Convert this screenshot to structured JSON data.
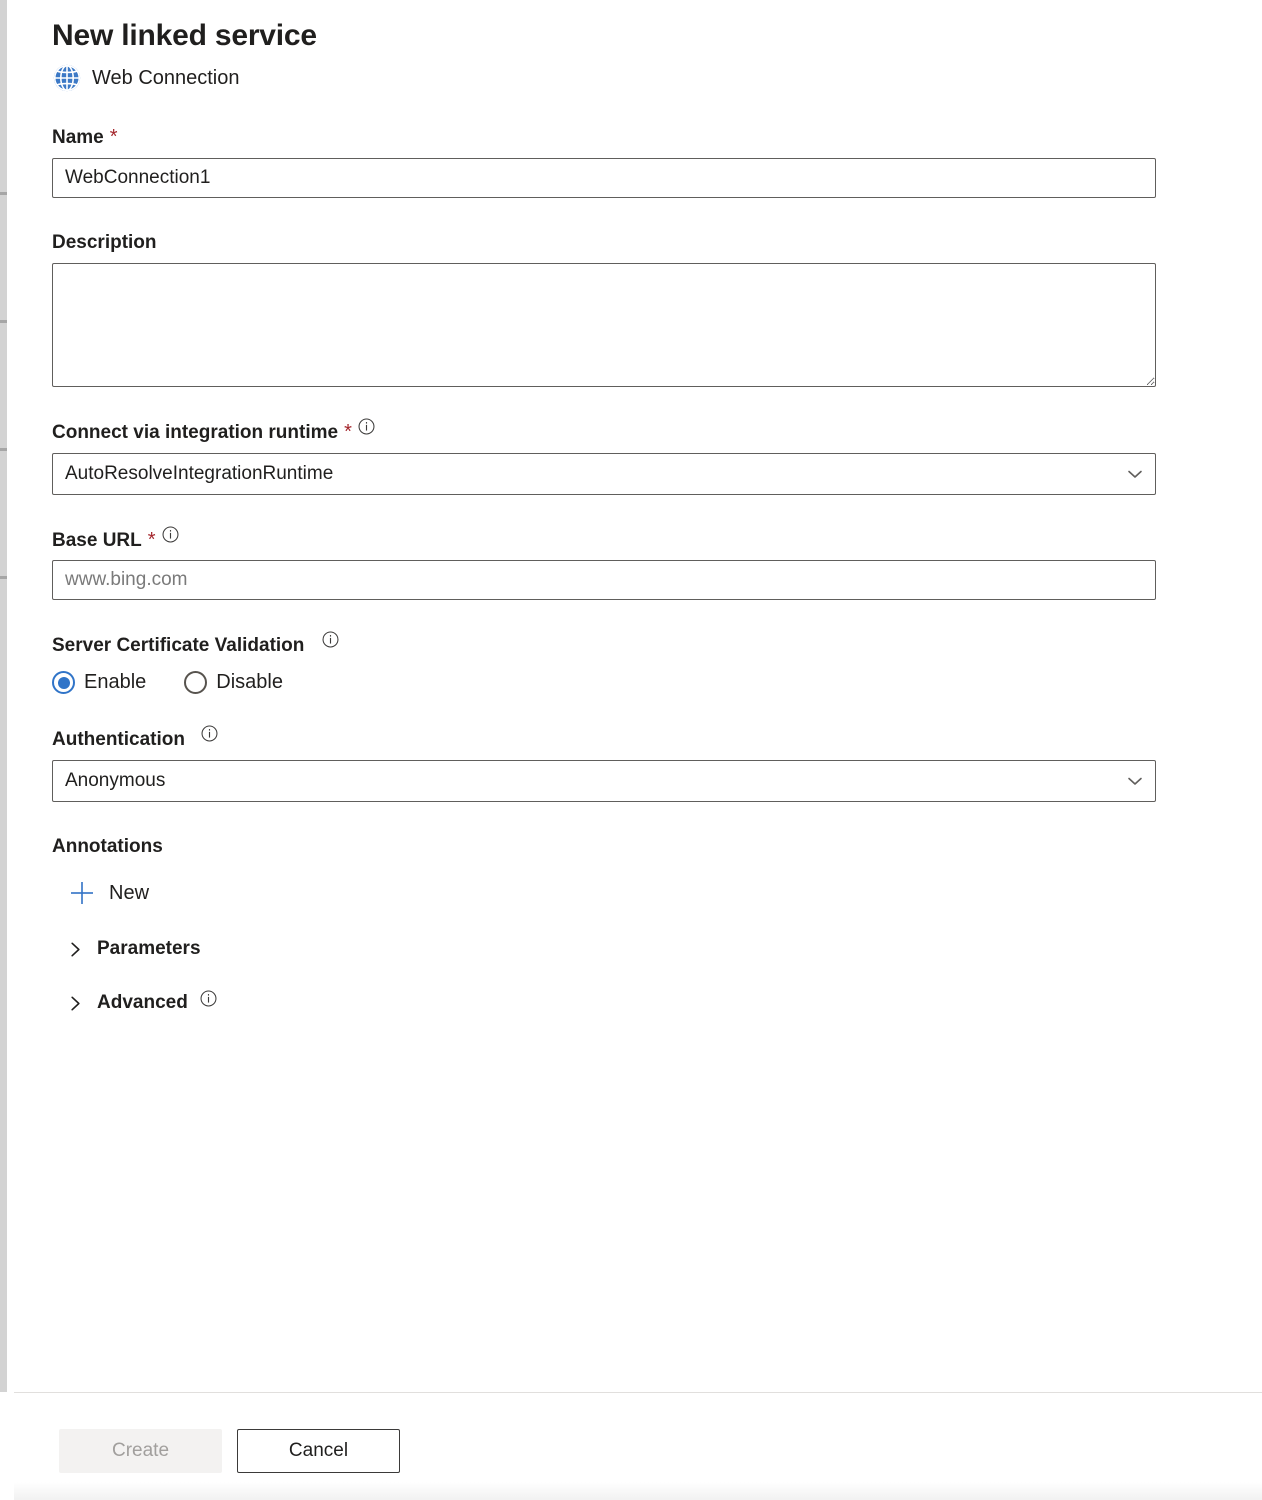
{
  "header": {
    "title": "New linked service",
    "service_icon": "globe-icon",
    "service_type": "Web Connection",
    "icon_color": "#3c79c6"
  },
  "theme": {
    "accent": "#3074c8",
    "required_marker": "#a4262c",
    "border": "#605e5c",
    "disabled_text": "#a19f9d"
  },
  "form": {
    "name": {
      "label": "Name",
      "required_marker": "*",
      "value": "WebConnection1",
      "placeholder": ""
    },
    "description": {
      "label": "Description",
      "value": "",
      "placeholder": ""
    },
    "integration_runtime": {
      "label": "Connect via integration runtime",
      "required_marker": "*",
      "info_icon": "info-icon",
      "value": "AutoResolveIntegrationRuntime",
      "options": [
        "AutoResolveIntegrationRuntime"
      ]
    },
    "base_url": {
      "label": "Base URL",
      "required_marker": "*",
      "info_icon": "info-icon",
      "value": "",
      "placeholder": "www.bing.com"
    },
    "server_certificate_validation": {
      "label": "Server Certificate Validation",
      "info_icon": "info-icon",
      "selected": "Enable",
      "options": [
        {
          "label": "Enable",
          "selected": true
        },
        {
          "label": "Disable",
          "selected": false
        }
      ]
    },
    "authentication": {
      "label": "Authentication",
      "info_icon": "info-icon",
      "value": "Anonymous",
      "options": [
        "Anonymous"
      ]
    },
    "annotations": {
      "label": "Annotations",
      "new_label": "New",
      "new_icon": "plus-icon"
    },
    "parameters_section": {
      "label": "Parameters",
      "chevron_icon": "chevron-right-icon",
      "expanded": false
    },
    "advanced_section": {
      "label": "Advanced",
      "chevron_icon": "chevron-right-icon",
      "info_icon": "info-icon",
      "expanded": false
    }
  },
  "footer": {
    "create_label": "Create",
    "create_disabled": true,
    "cancel_label": "Cancel"
  }
}
